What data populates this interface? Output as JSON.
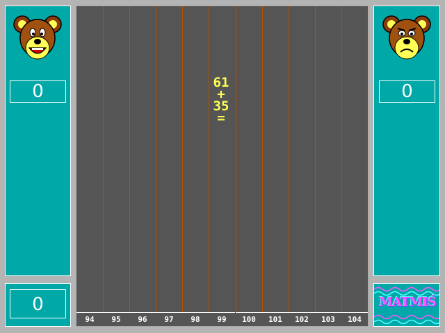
{
  "left_panel": {
    "score": "0"
  },
  "right_panel": {
    "score": "0"
  },
  "bottom_left": {
    "score": "0"
  },
  "problem": {
    "operand1": "61",
    "operator": "+",
    "operand2": "35",
    "equals": "="
  },
  "columns": [
    "94",
    "95",
    "96",
    "97",
    "98",
    "99",
    "100",
    "101",
    "102",
    "103",
    "104"
  ],
  "logo": {
    "text": "MATMIŚ"
  },
  "colors": {
    "panel": "#00a8a8",
    "board": "#555555",
    "lines": "#b45000",
    "problem": "#ffff55"
  }
}
